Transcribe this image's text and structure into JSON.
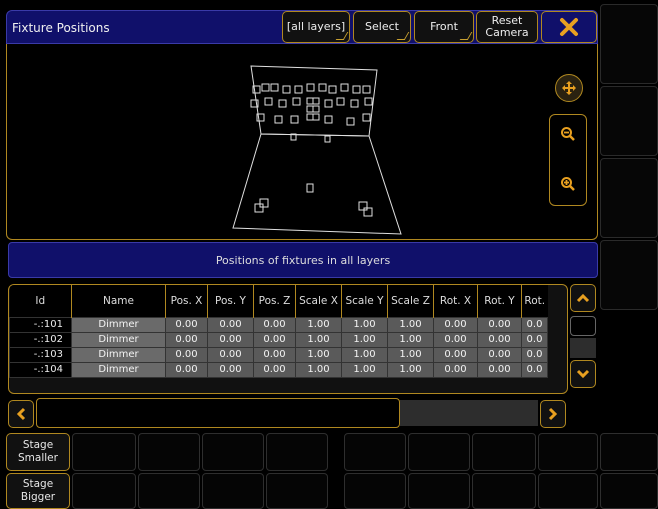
{
  "window": {
    "title": "Fixture Positions",
    "buttons": {
      "layers": "[all layers]",
      "select": "Select",
      "front": "Front",
      "reset_camera_line1": "Reset",
      "reset_camera_line2": "Camera"
    }
  },
  "viewport": {
    "controls": [
      "move-icon",
      "zoom-out-icon",
      "zoom-in-icon"
    ]
  },
  "caption": "Positions of fixtures in all layers",
  "table": {
    "columns": [
      "Id",
      "Name",
      "Pos. X",
      "Pos. Y",
      "Pos. Z",
      "Scale X",
      "Scale Y",
      "Scale Z",
      "Rot. X",
      "Rot. Y",
      "Rot."
    ],
    "rows": [
      {
        "id": "-.:101",
        "name": "Dimmer",
        "values": [
          "0.00",
          "0.00",
          "0.00",
          "1.00",
          "1.00",
          "1.00",
          "0.00",
          "0.00",
          "0.0"
        ]
      },
      {
        "id": "-.:102",
        "name": "Dimmer",
        "values": [
          "0.00",
          "0.00",
          "0.00",
          "1.00",
          "1.00",
          "1.00",
          "0.00",
          "0.00",
          "0.0"
        ]
      },
      {
        "id": "-.:103",
        "name": "Dimmer",
        "values": [
          "0.00",
          "0.00",
          "0.00",
          "1.00",
          "1.00",
          "1.00",
          "0.00",
          "0.00",
          "0.0"
        ]
      },
      {
        "id": "-.:104",
        "name": "Dimmer",
        "values": [
          "0.00",
          "0.00",
          "0.00",
          "1.00",
          "1.00",
          "1.00",
          "0.00",
          "0.00",
          "0.0"
        ]
      }
    ]
  },
  "bottom": {
    "stage_smaller_1": "Stage",
    "stage_smaller_2": "Smaller",
    "stage_bigger_1": "Stage",
    "stage_bigger_2": "Bigger"
  },
  "colors": {
    "accent": "#b08820",
    "title_bg": "#10106a",
    "cell_bg": "#5a5a5a"
  }
}
